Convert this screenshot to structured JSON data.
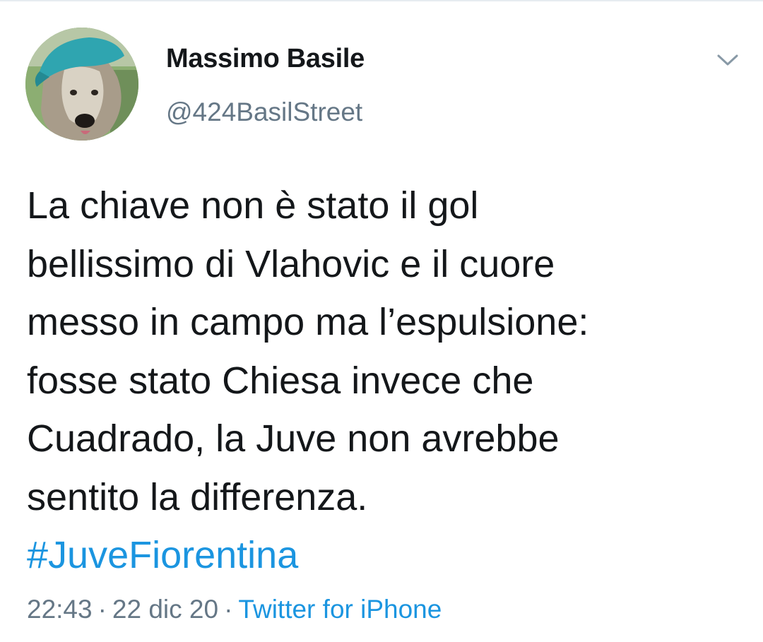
{
  "tweet": {
    "author": {
      "display_name": "Massimo Basile",
      "handle": "@424BasilStreet",
      "avatar_icon": "dog-avatar-icon"
    },
    "menu_icon": "chevron-down-icon",
    "text_lines": [
      "La chiave non è stato il gol",
      "bellissimo di Vlahovic e il cuore",
      "messo in campo ma l’espulsione:",
      "fosse stato Chiesa invece che",
      "Cuadrado, la Juve non avrebbe",
      "sentito la differenza."
    ],
    "hashtag": "#JuveFiorentina",
    "time": "22:43",
    "date": "22 dic 20",
    "separator": "·",
    "source": "Twitter for iPhone"
  },
  "colors": {
    "text": "#14171a",
    "secondary": "#657786",
    "link": "#1b95e0",
    "divider": "#e6ecf0"
  }
}
